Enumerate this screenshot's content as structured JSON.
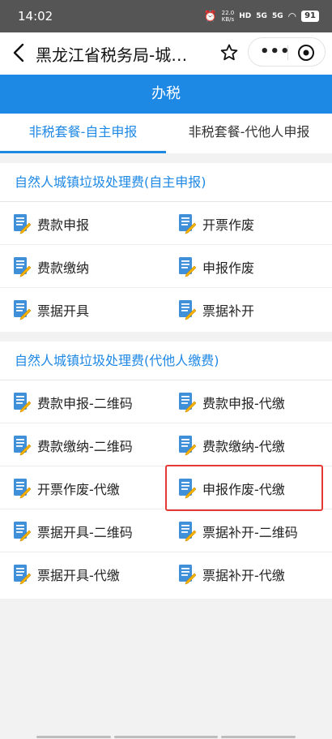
{
  "status_bar": {
    "time": "14:02",
    "net_speed_value": "22.0",
    "net_speed_unit": "KB/s",
    "hd_label": "HD",
    "signal_1": "5G",
    "signal_2": "5G",
    "battery": "91"
  },
  "title_bar": {
    "title": "黑龙江省税务局-城…"
  },
  "header": {
    "title": "办税"
  },
  "tabs": [
    {
      "label": "非税套餐-自主申报",
      "active": true
    },
    {
      "label": "非税套餐-代他人申报",
      "active": false
    }
  ],
  "sections": [
    {
      "title": "自然人城镇垃圾处理费(自主申报)",
      "items": [
        "费款申报",
        "开票作废",
        "费款缴纳",
        "申报作废",
        "票据开具",
        "票据补开"
      ]
    },
    {
      "title": "自然人城镇垃圾处理费(代他人缴费)",
      "items": [
        "费款申报-二维码",
        "费款申报-代缴",
        "费款缴纳-二维码",
        "费款缴纳-代缴",
        "开票作废-代缴",
        "申报作废-代缴",
        "票据开具-二维码",
        "票据补开-二维码",
        "票据开具-代缴",
        "票据补开-代缴"
      ]
    }
  ],
  "colors": {
    "accent": "#1e88e5",
    "highlight": "#e53935",
    "icon_blue": "#3f8fd9",
    "icon_pencil": "#f5b400"
  }
}
